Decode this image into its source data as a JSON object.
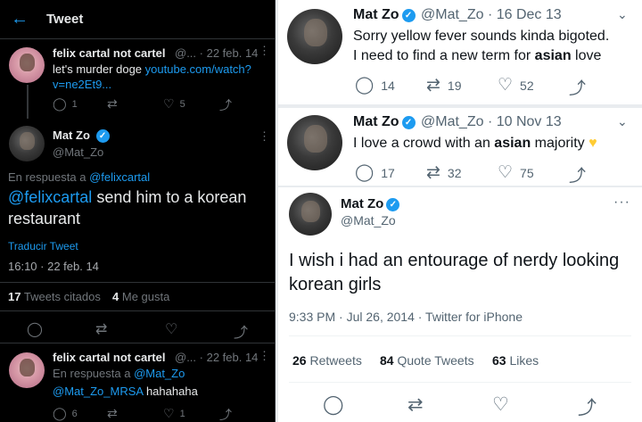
{
  "left": {
    "header": {
      "back_icon": "←",
      "title": "Tweet"
    },
    "tweet1": {
      "name": "felix cartal not cartel",
      "meta": "@... · 22 feb. 14",
      "text_pre": "let's murder doge ",
      "link": "youtube.com/watch?v=ne2Et9...",
      "replies": "1",
      "retweets": "",
      "likes": "5"
    },
    "main": {
      "name": "Mat Zo",
      "handle": "@Mat_Zo",
      "reply_to_label": "En respuesta a ",
      "reply_to": "@felixcartal",
      "text_mention": "@felixcartal",
      "text_rest": " send him to a korean restaurant",
      "translate": "Traducir Tweet",
      "timestamp": "16:10 · 22 feb. 14",
      "quote_count": "17",
      "quote_label": "Tweets citados",
      "likes_count": "4",
      "likes_label": "Me gusta"
    },
    "tweet3": {
      "name": "felix cartal not cartel",
      "meta": "@... · 22 feb. 14",
      "reply_to_label": "En respuesta a ",
      "reply_to": "@Mat_Zo",
      "text_mention": "@Mat_Zo_MRSA",
      "text_rest": " hahahaha",
      "replies": "6",
      "retweets": "",
      "likes": "1"
    }
  },
  "right": {
    "tweetA": {
      "name": "Mat Zo",
      "handle": "@Mat_Zo",
      "date": "· 16 Dec 13",
      "text_a": "Sorry yellow fever sounds kinda bigoted.",
      "text_b": "I need to find a new term for ",
      "text_bold": "asian",
      "text_c": " love",
      "replies": "14",
      "retweets": "19",
      "likes": "52"
    },
    "tweetB": {
      "name": "Mat Zo",
      "handle": "@Mat_Zo",
      "date": "· 10 Nov 13",
      "text_a": "I love a crowd with an ",
      "text_bold": "asian",
      "text_c": " majority ",
      "heart": "♥",
      "replies": "17",
      "retweets": "32",
      "likes": "75"
    },
    "tweetC": {
      "name": "Mat Zo",
      "handle": "@Mat_Zo",
      "text": "I wish i had an entourage of nerdy looking korean girls",
      "timestamp": "9:33 PM · Jul 26, 2014 · Twitter for iPhone",
      "retweets_count": "26",
      "retweets_label": "Retweets",
      "quotes_count": "84",
      "quotes_label": "Quote Tweets",
      "likes_count": "63",
      "likes_label": "Likes"
    }
  },
  "icons": {
    "reply": "reply-icon",
    "retweet": "retweet-icon",
    "like": "heart-icon",
    "share": "share-icon",
    "more": "more-icon",
    "verified": "verified-badge-icon"
  }
}
